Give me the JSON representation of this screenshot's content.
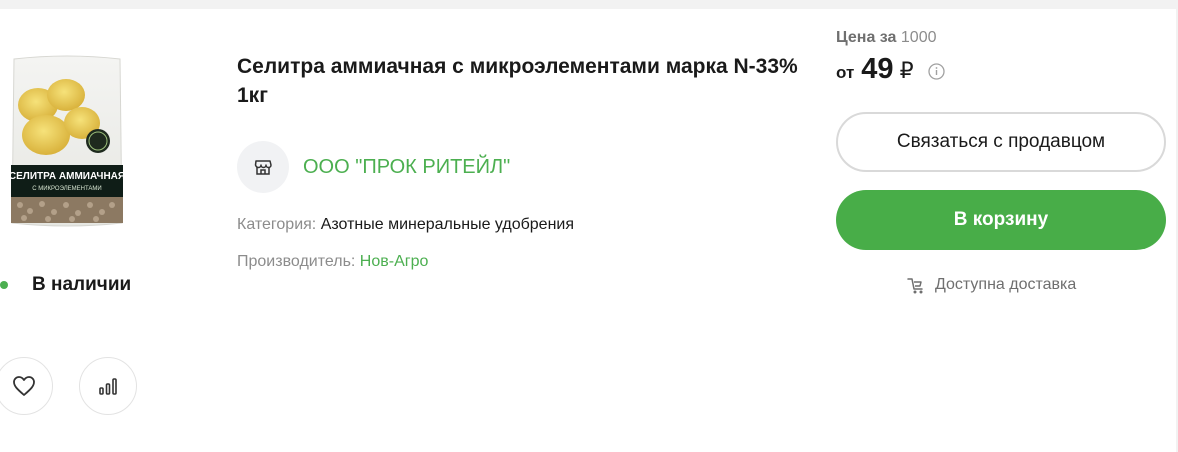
{
  "product": {
    "image": {
      "icon": "fertilizer-bag-image",
      "bag_title": "СЕЛИТРА АММИАЧНАЯ",
      "bag_subtitle": "С МИКРОЭЛЕМЕНТАМИ"
    },
    "stock_label": "В наличии",
    "title": "Селитра аммиачная с микроэлементами марка N-33% 1кг",
    "seller": {
      "icon": "store-icon",
      "name": "ООО \"ПРОК РИТЕЙЛ\""
    },
    "category": {
      "label": "Категория:",
      "value": "Азотные минеральные удобрения"
    },
    "manufacturer": {
      "label": "Производитель:",
      "value": "Нов-Агро"
    }
  },
  "actions": {
    "favorite_icon": "heart-icon",
    "compare_icon": "compare-icon"
  },
  "price": {
    "caption_prefix": "Цена за",
    "caption_qty": "1000",
    "from_label": "от",
    "value": "49",
    "currency": "₽",
    "info_icon": "info-icon"
  },
  "buttons": {
    "contact_label": "Связаться с продавцом",
    "cart_label": "В корзину"
  },
  "delivery": {
    "icon": "delivery-cart-icon",
    "label": "Доступна доставка"
  },
  "colors": {
    "accent_green": "#48ad48",
    "link_green": "#4caf50",
    "muted_text": "#8c8c8c"
  }
}
